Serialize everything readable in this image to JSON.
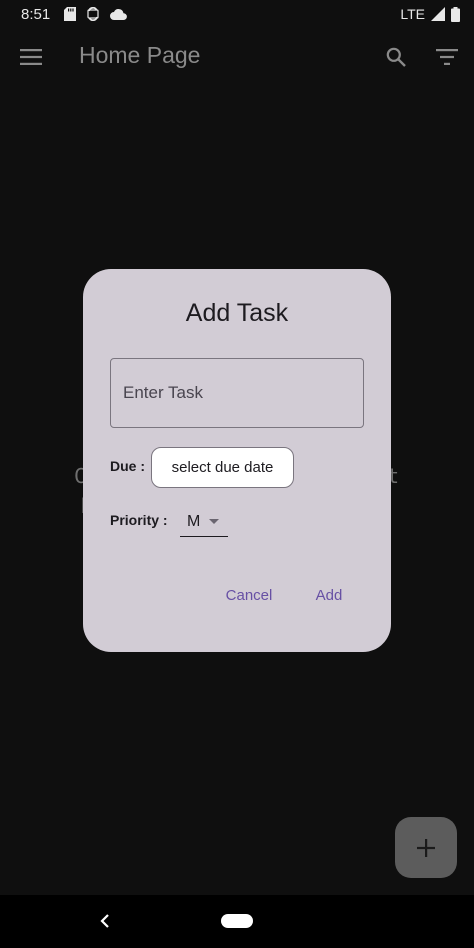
{
  "status_bar": {
    "time": "8:51",
    "network": "LTE",
    "icons": [
      "sd-card-icon",
      "sync-icon",
      "cloud-icon",
      "signal-icon",
      "battery-icon"
    ]
  },
  "app_bar": {
    "title": "Home Page",
    "icons": [
      "menu-icon",
      "search-icon",
      "filter-icon"
    ]
  },
  "background": {
    "empty_line_1": "C                       t",
    "empty_line_2": "but                  sks"
  },
  "dialog": {
    "title": "Add Task",
    "task_placeholder": "Enter Task",
    "task_value": "",
    "due_label": "Due :",
    "due_button_label": "select due date",
    "priority_label": "Priority :",
    "priority_value": "M",
    "cancel_label": "Cancel",
    "add_label": "Add"
  },
  "fab": {
    "icon": "plus-icon"
  },
  "colors": {
    "background": "#0f0f0f",
    "dialog_bg": "#d2ccd5",
    "accent": "#6750a4",
    "fab_bg": "#5c5c5c"
  }
}
